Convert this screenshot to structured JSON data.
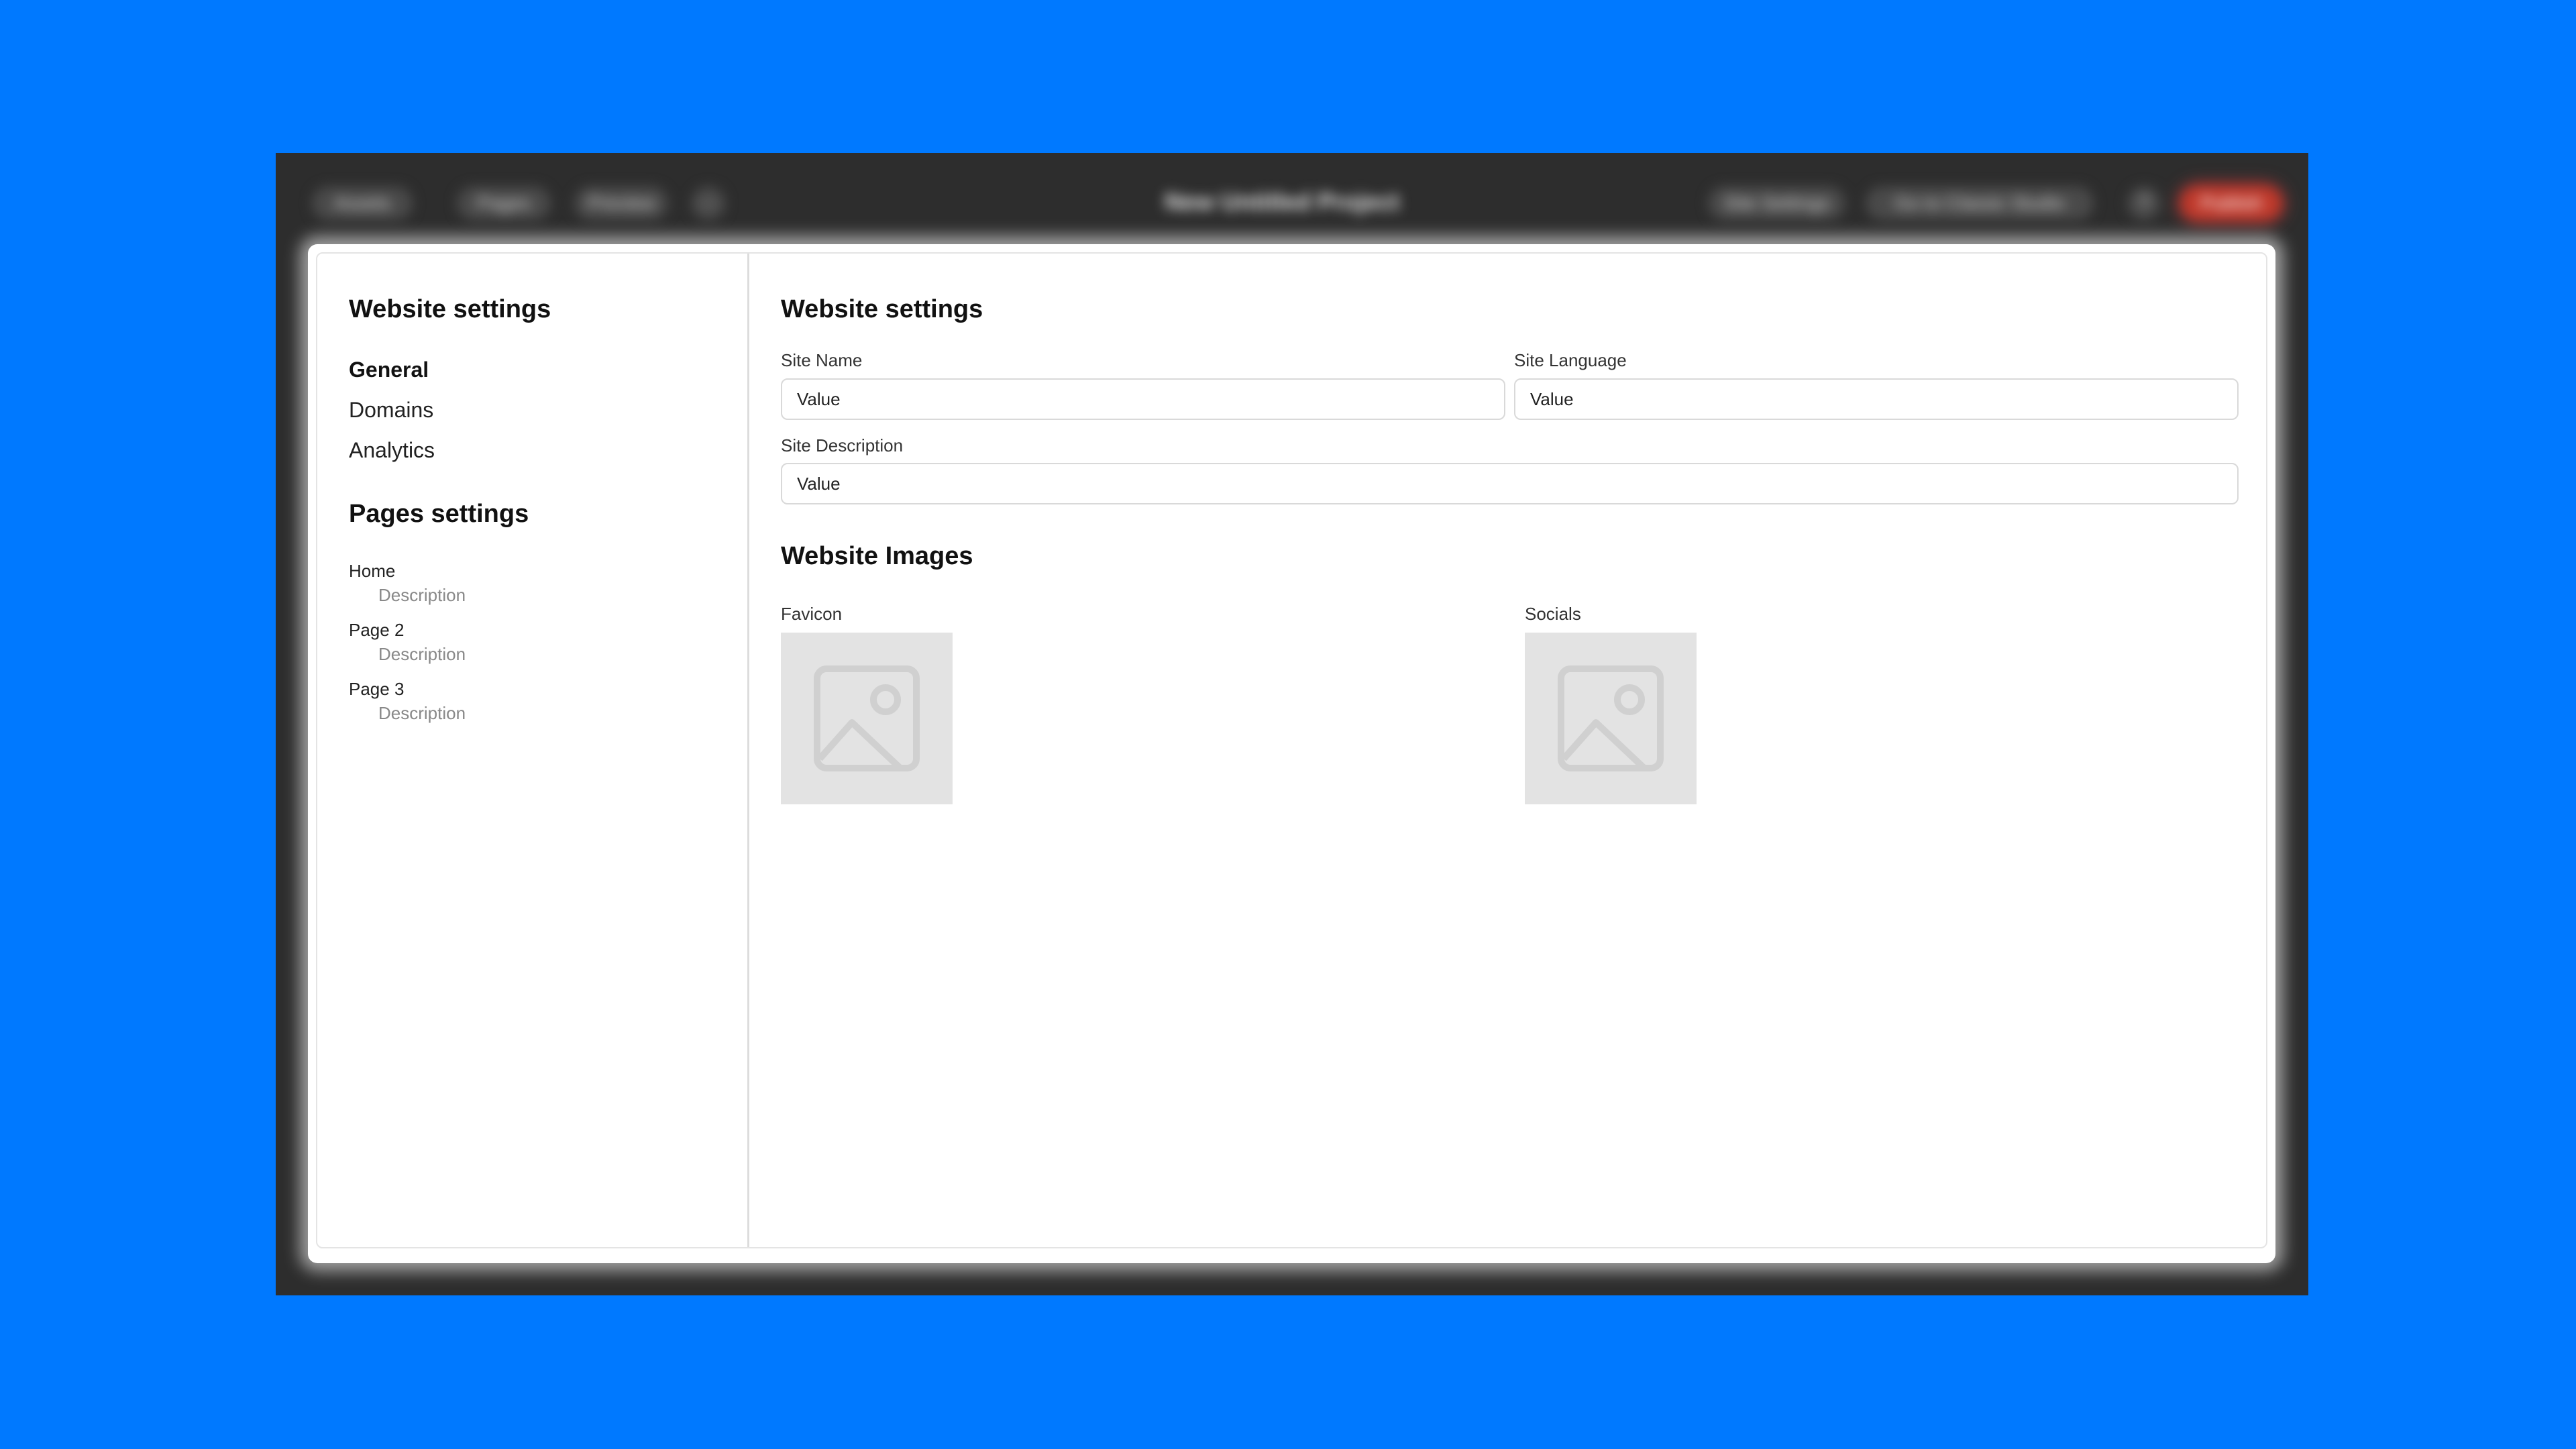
{
  "toolbar": {
    "left_buttons": [
      "Assets",
      "Pages",
      "Preview"
    ],
    "project_title": "New Untitled Project",
    "right_buttons": [
      "Site Settings",
      "Go to Classic Studio"
    ],
    "publish_label": "Publish"
  },
  "sidebar": {
    "website_settings_title": "Website settings",
    "items": [
      {
        "label": "General",
        "active": true
      },
      {
        "label": "Domains",
        "active": false
      },
      {
        "label": "Analytics",
        "active": false
      }
    ],
    "pages_settings_title": "Pages settings",
    "pages": [
      {
        "name": "Home",
        "description": "Description"
      },
      {
        "name": "Page 2",
        "description": "Description"
      },
      {
        "name": "Page 3",
        "description": "Description"
      }
    ]
  },
  "main": {
    "title": "Website settings",
    "site_name": {
      "label": "Site Name",
      "value": "Value"
    },
    "site_language": {
      "label": "Site Language",
      "value": "Value"
    },
    "site_description": {
      "label": "Site Description",
      "value": "Value"
    },
    "images_title": "Website Images",
    "favicon_label": "Favicon",
    "socials_label": "Socials"
  },
  "colors": {
    "background": "#0079ff",
    "frame": "#2d2d2d",
    "placeholder": "#e3e3e3"
  }
}
